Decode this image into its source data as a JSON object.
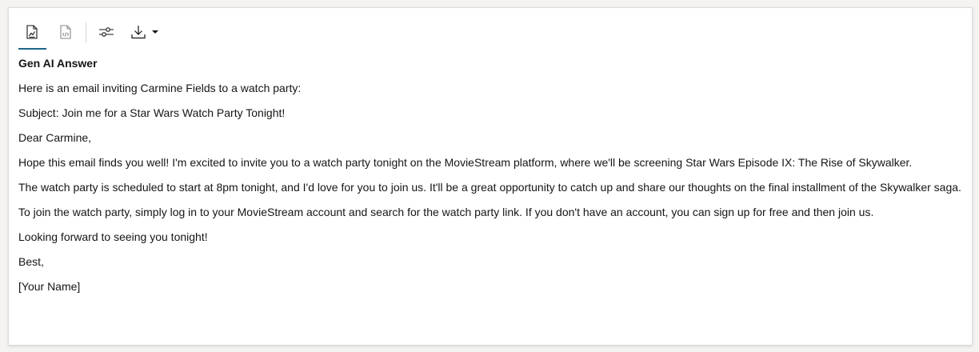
{
  "toolbar": {
    "items": [
      {
        "icon": "chart-document-icon",
        "selected": true
      },
      {
        "icon": "code-document-icon",
        "selected": false
      },
      {
        "icon": "sliders-icon",
        "selected": false
      },
      {
        "icon": "download-icon",
        "selected": false
      },
      {
        "icon": "caret-down-icon",
        "selected": false
      }
    ],
    "accent_color": "#1d6586"
  },
  "answer": {
    "heading": "Gen AI Answer",
    "paragraphs": [
      "Here is an email inviting Carmine Fields to a watch party:",
      "Subject: Join me for a Star Wars Watch Party Tonight!",
      "Dear Carmine,",
      "Hope this email finds you well! I'm excited to invite you to a watch party tonight on the MovieStream platform, where we'll be screening Star Wars Episode IX: The Rise of Skywalker.",
      "The watch party is scheduled to start at 8pm tonight, and I'd love for you to join us. It'll be a great opportunity to catch up and share our thoughts on the final installment of the Skywalker saga.",
      "To join the watch party, simply log in to your MovieStream account and search for the watch party link. If you don't have an account, you can sign up for free and then join us.",
      "Looking forward to seeing you tonight!",
      "Best,",
      "[Your Name]"
    ]
  }
}
